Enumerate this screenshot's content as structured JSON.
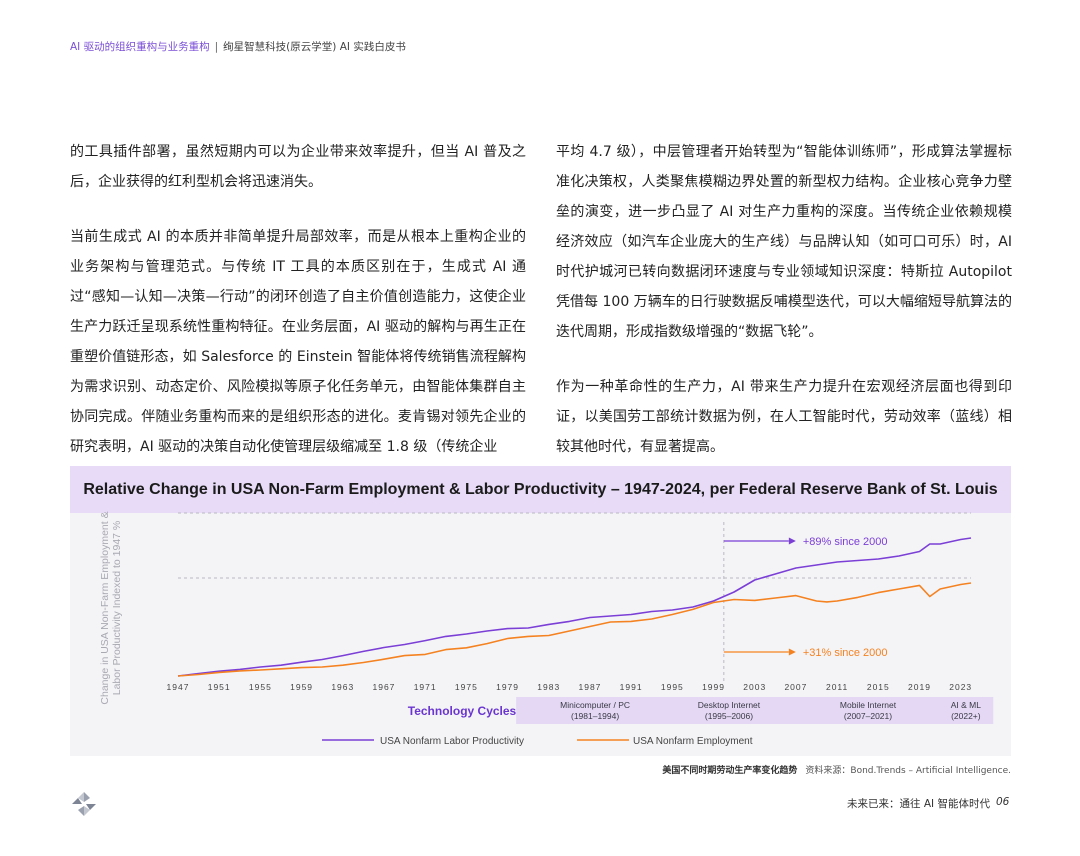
{
  "header": {
    "section": "AI 驱动的组织重构与业务重构",
    "separator": "|",
    "doc": "绚星智慧科技(原云学堂) AI 实践白皮书"
  },
  "left_paragraphs": [
    "的工具插件部署，虽然短期内可以为企业带来效率提升，但当 AI 普及之后，企业获得的红利型机会将迅速消失。",
    "当前生成式 AI 的本质并非简单提升局部效率，而是从根本上重构企业的业务架构与管理范式。与传统 IT 工具的本质区别在于，生成式 AI 通过“感知—认知—决策—行动”的闭环创造了自主价值创造能力，这使企业生产力跃迁呈现系统性重构特征。在业务层面，AI 驱动的解构与再生正在重塑价值链形态，如 Salesforce 的 Einstein 智能体将传统销售流程解构为需求识别、动态定价、风险模拟等原子化任务单元，由智能体集群自主协同完成。伴随业务重构而来的是组织形态的进化。麦肯锡对领先企业的研究表明，AI 驱动的决策自动化使管理层级缩减至 1.8 级（传统企业"
  ],
  "right_paragraphs": [
    "平均 4.7 级），中层管理者开始转型为“智能体训练师”，形成算法掌握标准化决策权，人类聚焦模糊边界处置的新型权力结构。企业核心竞争力壁垒的演变，进一步凸显了 AI 对生产力重构的深度。当传统企业依赖规模经济效应（如汽车企业庞大的生产线）与品牌认知（如可口可乐）时，AI 时代护城河已转向数据闭环速度与专业领域知识深度：特斯拉 Autopilot 凭借每 100 万辆车的日行驶数据反哺模型迭代，可以大幅缩短导航算法的迭代周期，形成指数级增强的“数据飞轮”。",
    "作为一种革命性的生产力，AI 带来生产力提升在宏观经济层面也得到印证，以美国劳工部统计数据为例，在人工智能时代，劳动效率（蓝线）相较其他时代，有显著提高。"
  ],
  "chart_data": {
    "type": "line",
    "title": "Relative Change in USA Non-Farm Employment & Labor Productivity – 1947-2024, per Federal Reserve Bank of St. Louis",
    "ylabel": "Change in USA Non-Farm Employment & Labor Productivity Indexed to 1947 %",
    "xlabel": "",
    "xlim": [
      1947,
      2024
    ],
    "ylim": [
      0,
      460
    ],
    "x_ticks": [
      "1947",
      "1951",
      "1955",
      "1959",
      "1963",
      "1967",
      "1971",
      "1975",
      "1979",
      "1983",
      "1987",
      "1991",
      "1995",
      "1999",
      "2003",
      "2007",
      "2011",
      "2015",
      "2019",
      "2023"
    ],
    "series": [
      {
        "name": "USA Nonfarm Labor Productivity",
        "color": "#7b3fd6",
        "x": [
          1947,
          1949,
          1951,
          1953,
          1955,
          1957,
          1959,
          1961,
          1963,
          1965,
          1967,
          1969,
          1971,
          1973,
          1975,
          1977,
          1979,
          1981,
          1983,
          1985,
          1987,
          1989,
          1991,
          1993,
          1995,
          1997,
          1999,
          2001,
          2003,
          2005,
          2007,
          2009,
          2011,
          2013,
          2015,
          2017,
          2019,
          2020,
          2021,
          2023,
          2024
        ],
        "y": [
          0,
          8,
          16,
          22,
          30,
          36,
          46,
          55,
          68,
          82,
          95,
          105,
          118,
          132,
          140,
          150,
          158,
          160,
          172,
          182,
          195,
          200,
          205,
          215,
          220,
          230,
          250,
          280,
          320,
          340,
          360,
          370,
          380,
          385,
          390,
          400,
          415,
          440,
          440,
          455,
          460
        ]
      },
      {
        "name": "USA Nonfarm Employment",
        "color": "#f58220",
        "x": [
          1947,
          1949,
          1951,
          1953,
          1955,
          1957,
          1959,
          1961,
          1963,
          1965,
          1967,
          1969,
          1971,
          1973,
          1975,
          1977,
          1979,
          1981,
          1983,
          1985,
          1987,
          1989,
          1991,
          1993,
          1995,
          1997,
          1999,
          2001,
          2003,
          2005,
          2007,
          2009,
          2010,
          2011,
          2013,
          2015,
          2017,
          2019,
          2020,
          2021,
          2023,
          2024
        ],
        "y": [
          0,
          5,
          12,
          17,
          20,
          24,
          28,
          30,
          36,
          45,
          56,
          68,
          72,
          88,
          94,
          108,
          125,
          132,
          135,
          150,
          165,
          180,
          182,
          190,
          205,
          222,
          245,
          255,
          252,
          260,
          268,
          250,
          247,
          250,
          262,
          278,
          290,
          302,
          265,
          290,
          305,
          310
        ]
      }
    ],
    "annotations": [
      {
        "text": "+89% since 2000",
        "color": "#7b3fd6"
      },
      {
        "text": "+31% since 2000",
        "color": "#f58220"
      }
    ],
    "technology_cycles": {
      "label": "Technology Cycles",
      "items": [
        {
          "name": "Minicomputer / PC",
          "range": "(1981–1994)",
          "start": 1981,
          "end": 1994
        },
        {
          "name": "Desktop Internet",
          "range": "(1995–2006)",
          "start": 1995,
          "end": 2006
        },
        {
          "name": "Mobile Internet",
          "range": "(2007–2021)",
          "start": 2007,
          "end": 2021
        },
        {
          "name": "AI & ML",
          "range": "(2022+)",
          "start": 2022,
          "end": 2025
        }
      ]
    },
    "legend_position": "bottom",
    "grid": false,
    "colors": {
      "title_band": "#e7dbf7",
      "cycle_box": "#e4d8f5",
      "cycle_label": "#6a35d0",
      "plot_bg": "#f4f4f7"
    }
  },
  "caption": {
    "main": "美国不同时期劳动生产率变化趋势",
    "source": "资料来源：Bond.Trends – Artificial Intelligence."
  },
  "footer": {
    "text": "未来已来：通往 AI 智能体时代",
    "page": "06"
  },
  "logo_icon": "pinwheel-logo-icon"
}
